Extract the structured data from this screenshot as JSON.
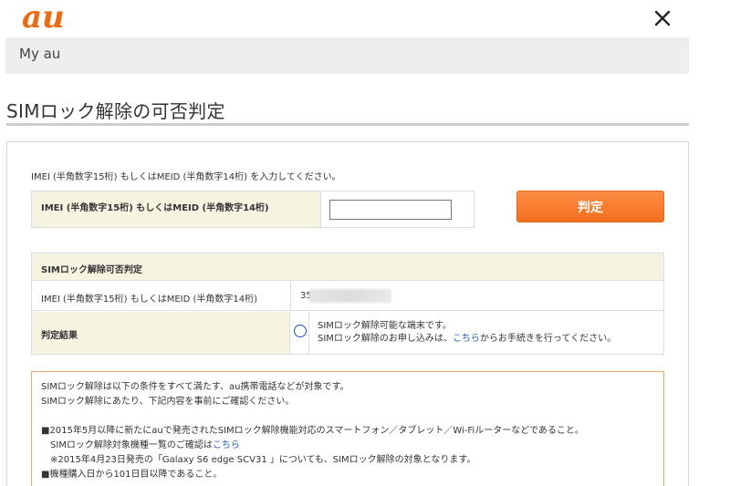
{
  "brand": {
    "logo_text": "au",
    "logo_color": "#ee6a10"
  },
  "nav": {
    "my_au": "My au"
  },
  "page": {
    "title": "SIMロック解除の可否判定"
  },
  "form": {
    "instruction": "IMEI (半角数字15桁) もしくはMEID (半角数字14桁) を入力してください。",
    "label": "IMEI (半角数字15桁) もしくはMEID (半角数字14桁)",
    "input_value": "",
    "submit_label": "判定"
  },
  "result": {
    "header": "SIMロック解除可否判定",
    "imei_label": "IMEI (半角数字15桁) もしくはMEID (半角数字14桁)",
    "imei_value_prefix": "35",
    "judgement_label": "判定結果",
    "mark": "○",
    "message_line1": "SIMロック解除可能な端末です。",
    "message_line2_pre": "SIMロック解除のお申し込みは、",
    "message_line2_link": "こちら",
    "message_line2_post": "からお手続きを行ってください。"
  },
  "conditions": {
    "intro1": "SIMロック解除は以下の条件をすべて満たす、au携帯電話などが対象です。",
    "intro2": "SIMロック解除にあたり、下記内容を事前にご確認ください。",
    "item1": "■2015年5月以降に新たにauで発売されたSIMロック解除機能対応のスマートフォン／タブレット／Wi-Fiルーターなどであること。",
    "item1_sub_pre": "SIMロック解除対象機種一覧のご確認は",
    "item1_sub_link": "こちら",
    "item1_note": "※2015年4月23日発売の「Galaxy S6 edge SCV31 」についても、SIMロック解除の対象となります。",
    "item2": "■機種購入日から101日目以降であること。"
  },
  "colors": {
    "accent_orange": "#f26f1d",
    "link_blue": "#1b5bc7",
    "header_beige": "#f7f3e1"
  }
}
